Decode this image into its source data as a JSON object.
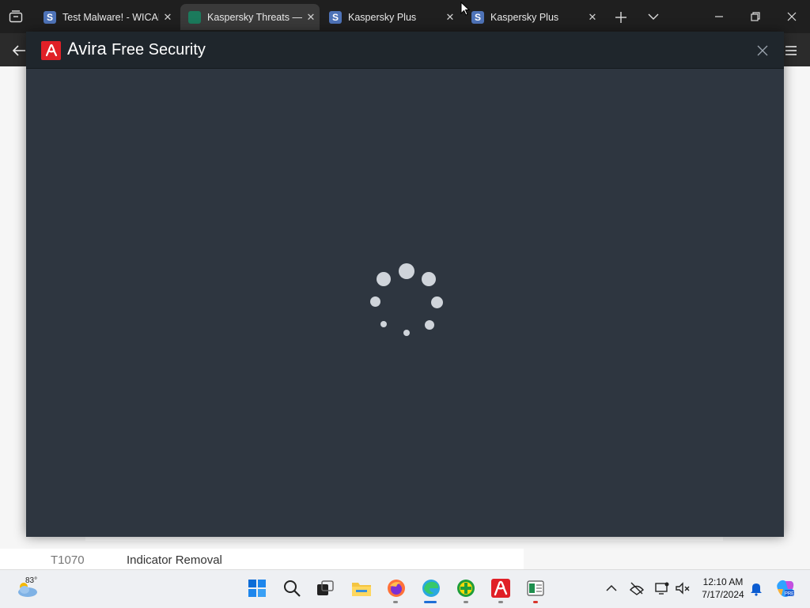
{
  "browser": {
    "tabs": [
      {
        "title": "Test Malware! - WICAR",
        "favicon": "s-icon",
        "close": "✕"
      },
      {
        "title": "Kaspersky Threats — T",
        "favicon": "kaspersky-icon",
        "close": "✕"
      },
      {
        "title": "Kaspersky Plus",
        "favicon": "s-icon",
        "close": "✕"
      },
      {
        "title": "Kaspersky Plus",
        "favicon": "s-icon",
        "close": "✕"
      }
    ],
    "favicon_letter": "S"
  },
  "page": {
    "row_id": "T1070",
    "row_name": "Indicator Removal"
  },
  "dialog": {
    "brand": "Avira",
    "product": "Free Security",
    "colors": {
      "accent": "#e02027",
      "background": "#2e3640",
      "header": "#1f262c"
    }
  },
  "taskbar": {
    "temperature": "83°",
    "time": "12:10 AM",
    "date": "7/17/2024",
    "apps": [
      "start-icon",
      "search-icon",
      "task-view-icon",
      "file-explorer-icon",
      "firefox-icon",
      "edge-icon",
      "quickheal-icon",
      "avira-icon",
      "notepad-icon"
    ]
  }
}
